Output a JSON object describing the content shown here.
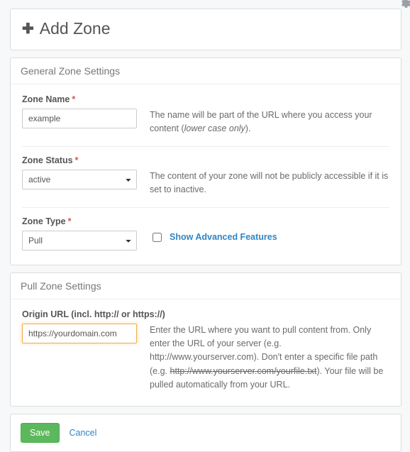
{
  "header": {
    "title": "Add Zone"
  },
  "general": {
    "section_title": "General Zone Settings",
    "zone_name": {
      "label": "Zone Name",
      "value": "example",
      "help_pre": "The name will be part of the URL where you access your content (",
      "help_ital": "lower case only",
      "help_post": ")."
    },
    "zone_status": {
      "label": "Zone Status",
      "value": "active",
      "help": "The content of your zone will not be publicly accessible if it is set to inactive."
    },
    "zone_type": {
      "label": "Zone Type",
      "value": "Pull",
      "advanced_label": "Show Advanced Features",
      "advanced_checked": false
    }
  },
  "pull": {
    "section_title": "Pull Zone Settings",
    "origin_url": {
      "label": "Origin URL (incl. http:// or https://)",
      "value": "https://yourdomain.com",
      "help_1": "Enter the URL where you want to pull content from. Only enter the URL of your server (e.g. http://www.yourserver.com). Don't enter a specific file path (e.g. ",
      "help_strike": "http://www.yourserver.com/yourfile.txt",
      "help_2": "). Your file will be pulled automatically from your URL."
    }
  },
  "actions": {
    "save": "Save",
    "cancel": "Cancel"
  }
}
